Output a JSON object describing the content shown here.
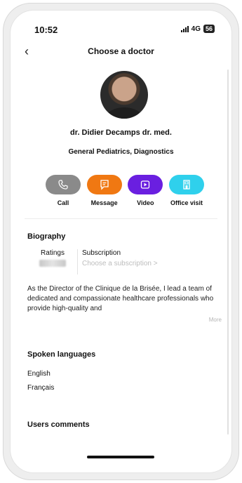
{
  "status_bar": {
    "time": "10:52",
    "network": "4G",
    "battery": "56"
  },
  "nav": {
    "title": "Choose a doctor"
  },
  "doctor": {
    "name": "dr.  Didier Decamps dr. med.",
    "specialty": "General Pediatrics, Diagnostics"
  },
  "actions": [
    {
      "label": "Call",
      "icon": "phone-icon",
      "color": "#8a8a8a"
    },
    {
      "label": "Message",
      "icon": "message-icon",
      "color": "#f07812"
    },
    {
      "label": "Video",
      "icon": "video-icon",
      "color": "#6a1fe0"
    },
    {
      "label": "Office visit",
      "icon": "office-icon",
      "color": "#2fd0ec"
    }
  ],
  "biography": {
    "title": "Biography",
    "ratings_label": "Ratings",
    "subscription_label": "Subscription",
    "subscription_placeholder": "Choose a subscription  >",
    "text": "As the Director of the Clinique de la Brisée, I lead a team of dedicated and compassionate healthcare professionals who provide high-quality and",
    "more": "More"
  },
  "languages": {
    "title": "Spoken languages",
    "items": [
      "English",
      "Français"
    ]
  },
  "comments": {
    "title": "Users comments"
  }
}
